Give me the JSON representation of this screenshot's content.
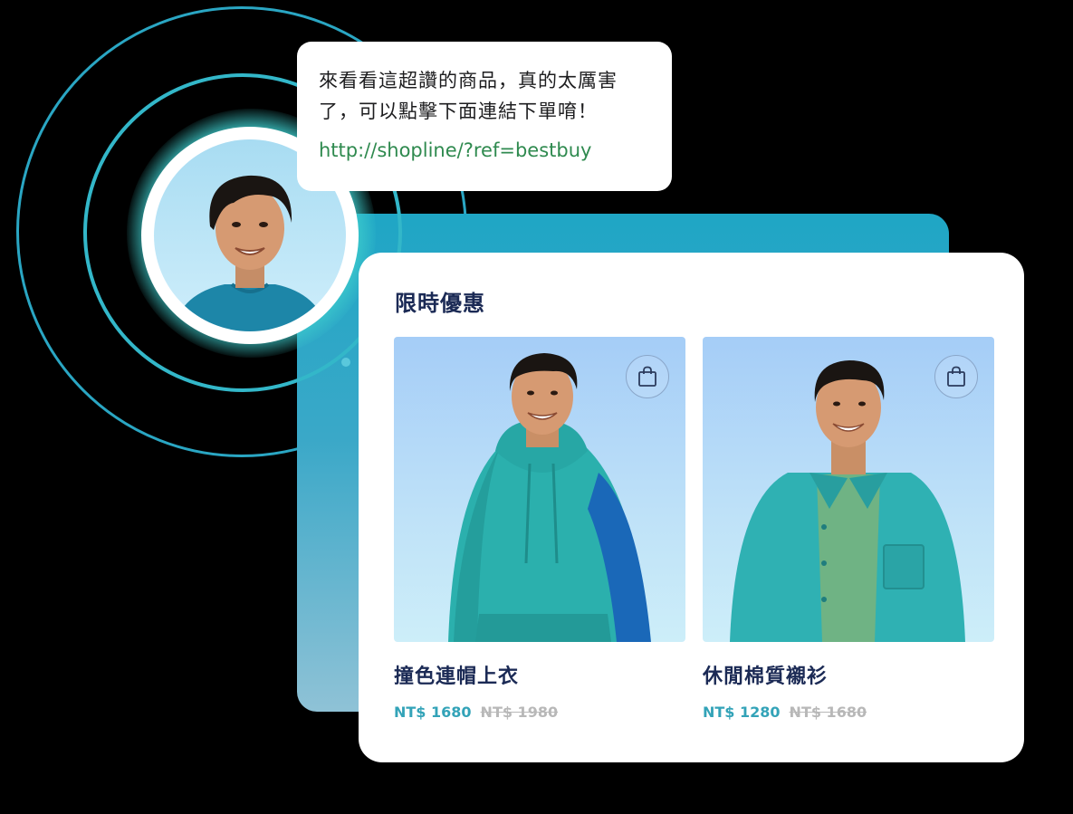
{
  "chat": {
    "message": "來看看這超讚的商品，真的太厲害了，可以點擊下面連結下單唷！",
    "link": "http://shopline/?ref=bestbuy"
  },
  "card": {
    "title": "限時優惠",
    "products": [
      {
        "name": "撞色連帽上衣",
        "price": "NT$ 1680",
        "original_price": "NT$ 1980",
        "icon": "shopping-bag-icon"
      },
      {
        "name": "休閒棉質襯衫",
        "price": "NT$ 1280",
        "original_price": "NT$ 1680",
        "icon": "shopping-bag-icon"
      }
    ]
  },
  "colors": {
    "accent": "#33a3b8",
    "link": "#2f8a4f",
    "title": "#1b2a55",
    "panel": "#1fa6c5"
  }
}
